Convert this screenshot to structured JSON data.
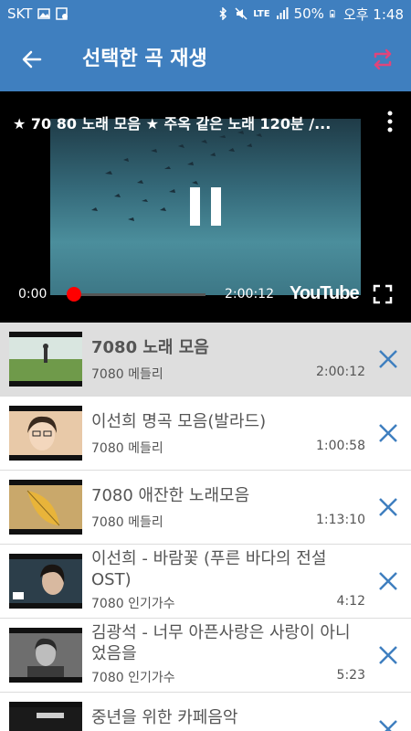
{
  "status_bar": {
    "carrier": "SKT",
    "battery": "50%",
    "time": "오후 1:48",
    "network": "LTE"
  },
  "app_bar": {
    "title": "선택한 곡 재생"
  },
  "player": {
    "video_title": "★ 70 80 노래 모음 ★ 주옥 같은 노래 120분 /...",
    "current_time": "0:00",
    "duration": "2:00:12",
    "logo_text": "YouTube",
    "progress": 0.0
  },
  "playlist": [
    {
      "title": "7080 노래 모음",
      "category": "7080 메들리",
      "duration": "2:00:12",
      "active": true
    },
    {
      "title": "이선희 명곡 모음(발라드)",
      "category": "7080 메들리",
      "duration": "1:00:58",
      "active": false
    },
    {
      "title": "7080 애잔한 노래모음",
      "category": "7080 메들리",
      "duration": "1:13:10",
      "active": false
    },
    {
      "title": "이선희 - 바람꽃 (푸른 바다의 전설 OST)",
      "category": "7080 인기가수",
      "duration": "4:12",
      "active": false
    },
    {
      "title": "김광석 - 너무 아픈사랑은 사랑이 아니었음을",
      "category": "7080 인기가수",
      "duration": "5:23",
      "active": false
    },
    {
      "title": "중년을 위한 카페음악",
      "category": "",
      "duration": "",
      "active": false
    }
  ],
  "colors": {
    "primary": "#3f7fbf",
    "accent_pink": "#e0457b",
    "remove_icon": "#3f7fbf",
    "progress_red": "#ff0000"
  }
}
